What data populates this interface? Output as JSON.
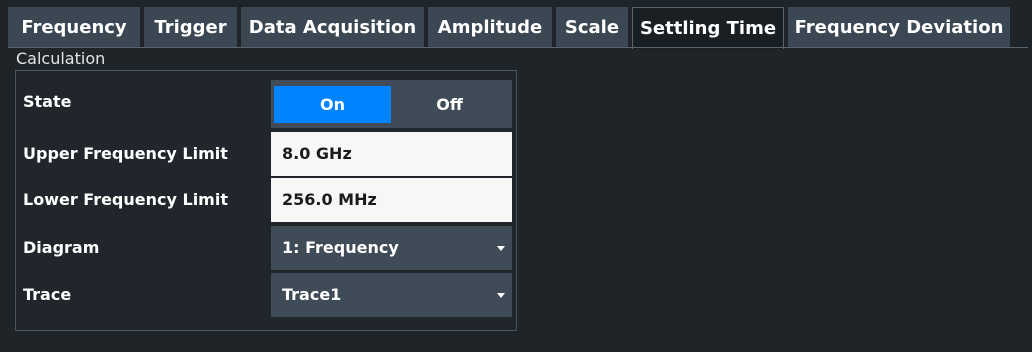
{
  "tabs": [
    {
      "label": "Frequency"
    },
    {
      "label": "Trigger"
    },
    {
      "label": "Data Acquisition"
    },
    {
      "label": "Amplitude"
    },
    {
      "label": "Scale"
    },
    {
      "label": "Settling Time"
    },
    {
      "label": "Frequency Deviation"
    }
  ],
  "active_tab": "Settling Time",
  "calculation": {
    "title": "Calculation",
    "state": {
      "label": "State",
      "on_label": "On",
      "off_label": "Off",
      "selected": "On"
    },
    "upper_frequency_limit": {
      "label": "Upper Frequency Limit",
      "value": "8.0 GHz"
    },
    "lower_frequency_limit": {
      "label": "Lower Frequency Limit",
      "value": "256.0 MHz"
    },
    "diagram": {
      "label": "Diagram",
      "value": "1: Frequency"
    },
    "trace": {
      "label": "Trace",
      "value": "Trace1"
    }
  },
  "colors": {
    "background": "#1f2428",
    "tab_background": "#3b4752",
    "active_tab_background": "#1a1f23",
    "accent": "#0084ff",
    "field_background": "#f7f7f7"
  },
  "icons": {
    "dropdown": "chevron-down-icon"
  }
}
